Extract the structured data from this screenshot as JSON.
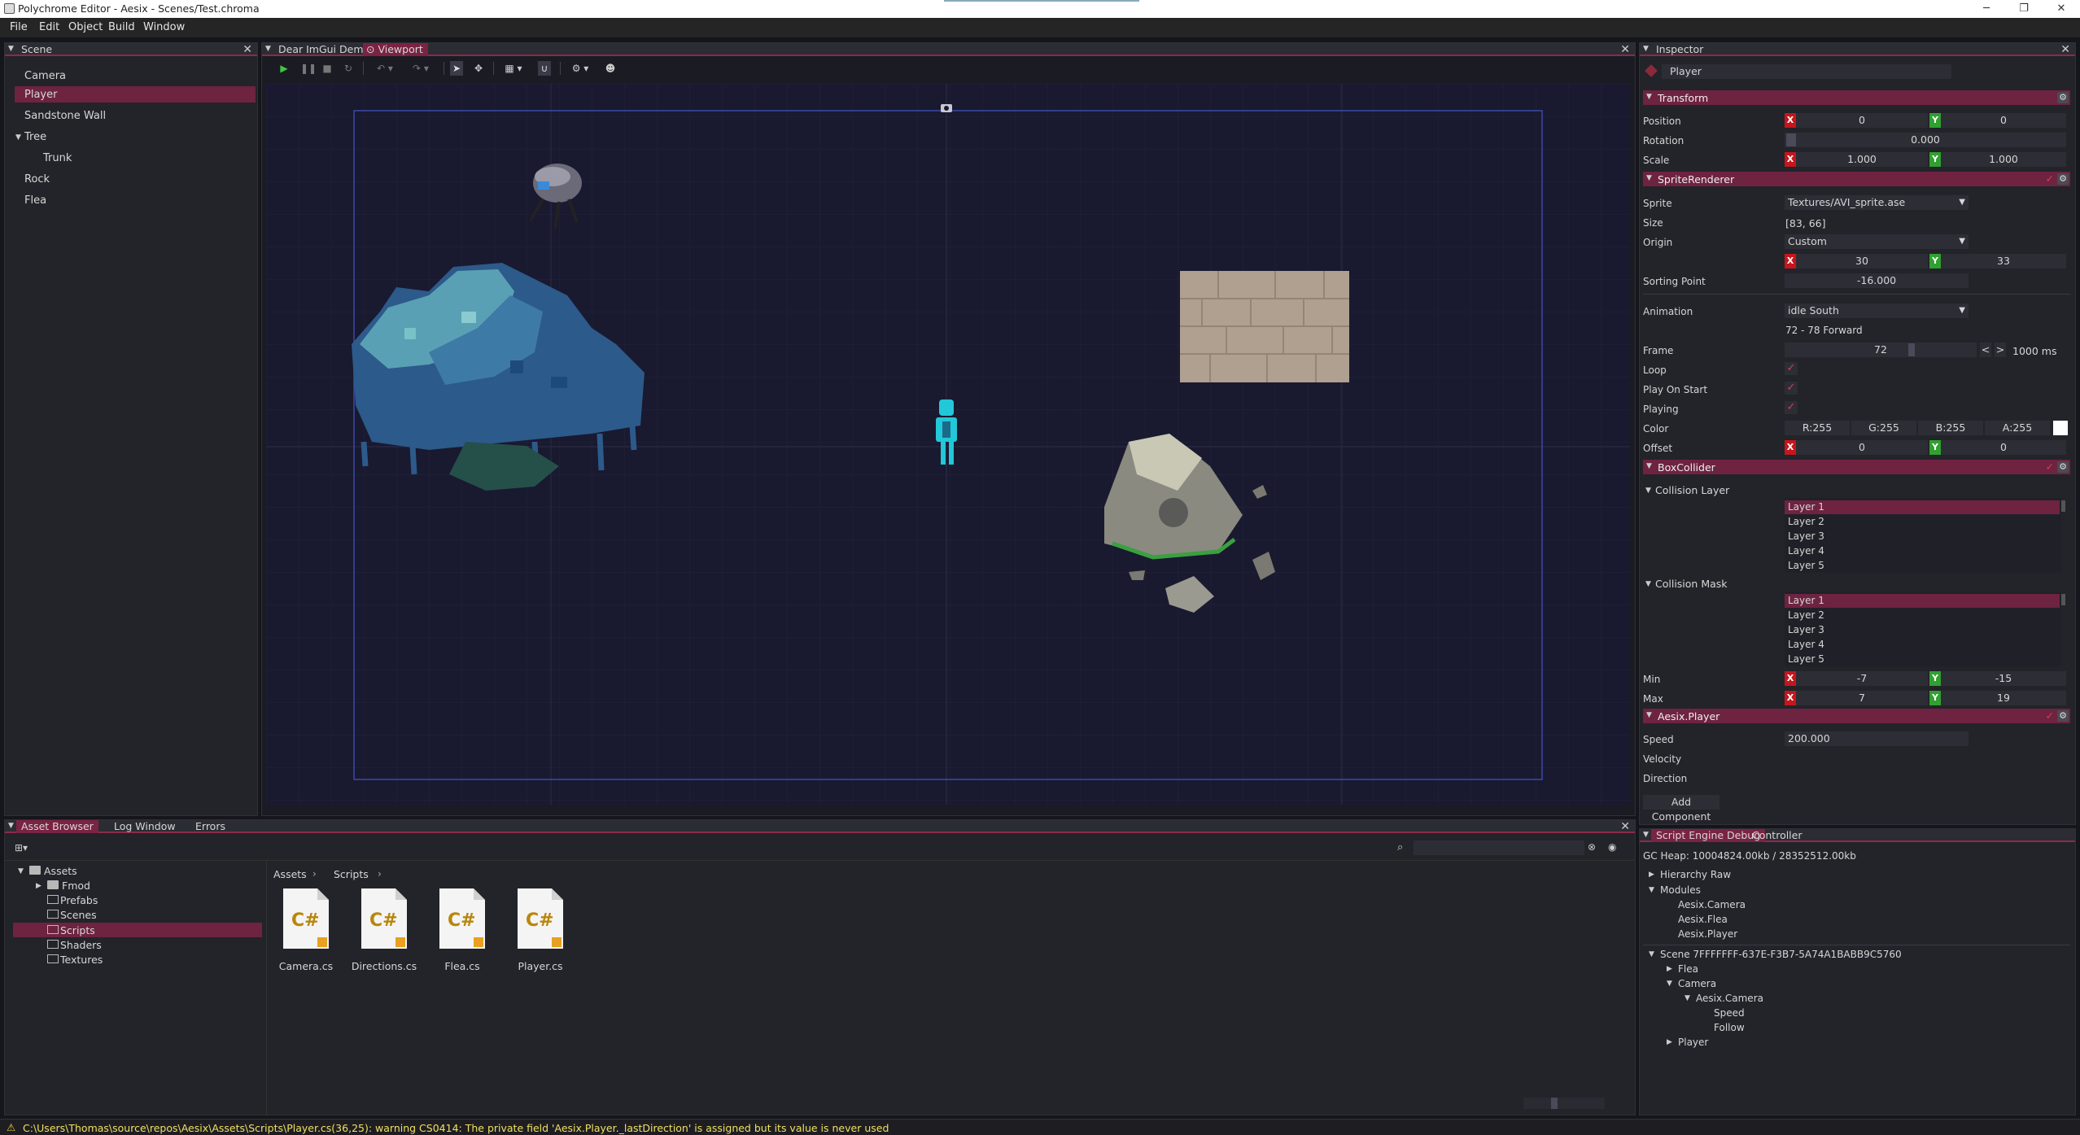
{
  "window": {
    "title": "Polychrome Editor - Aesix - Scenes/Test.chroma",
    "minimize": "─",
    "maximize": "❐",
    "close": "✕"
  },
  "menu": [
    "File",
    "Edit",
    "Object",
    "Build",
    "Window"
  ],
  "scene": {
    "tab": "Scene",
    "items": [
      "Camera",
      "Player",
      "Sandstone Wall",
      "Tree",
      "Trunk",
      "Rock",
      "Flea"
    ]
  },
  "viewport": {
    "tabs": [
      "Dear ImGui Demo",
      "Viewport"
    ]
  },
  "inspector": {
    "tab": "Inspector",
    "object_name": "Player",
    "transform": {
      "header": "Transform",
      "position_label": "Position",
      "position_x": "0",
      "position_y": "0",
      "rotation_label": "Rotation",
      "rotation": "0.000",
      "scale_label": "Scale",
      "scale_x": "1.000",
      "scale_y": "1.000"
    },
    "sprite_renderer": {
      "header": "SpriteRenderer",
      "sprite_label": "Sprite",
      "sprite": "Textures/AVI_sprite.ase",
      "size_label": "Size",
      "size": "[83, 66]",
      "origin_label": "Origin",
      "origin": "Custom",
      "origin_x": "30",
      "origin_y": "33",
      "sorting_label": "Sorting Point",
      "sorting": "-16.000",
      "animation_label": "Animation",
      "animation": "idle South",
      "anim_range": "72 - 78 Forward",
      "frame_label": "Frame",
      "frame": "72",
      "frame_ms": "1000 ms",
      "loop_label": "Loop",
      "play_on_start_label": "Play On Start",
      "playing_label": "Playing",
      "color_label": "Color",
      "color_r": "R:255",
      "color_g": "G:255",
      "color_b": "B:255",
      "color_a": "A:255",
      "offset_label": "Offset",
      "offset_x": "0",
      "offset_y": "0"
    },
    "box_collider": {
      "header": "BoxCollider",
      "collision_layer_label": "Collision Layer",
      "collision_mask_label": "Collision Mask",
      "layers": [
        "Layer 1",
        "Layer 2",
        "Layer 3",
        "Layer 4",
        "Layer 5"
      ],
      "min_label": "Min",
      "min_x": "-7",
      "min_y": "-15",
      "max_label": "Max",
      "max_x": "7",
      "max_y": "19"
    },
    "player": {
      "header": "Aesix.Player",
      "speed_label": "Speed",
      "speed": "200.000",
      "velocity_label": "Velocity",
      "direction_label": "Direction"
    },
    "add_component": "Add Component"
  },
  "assets": {
    "tabs": [
      "Asset Browser",
      "Log Window",
      "Errors"
    ],
    "tree": [
      "Assets",
      "Fmod",
      "Prefabs",
      "Scenes",
      "Scripts",
      "Shaders",
      "Textures"
    ],
    "breadcrumb": [
      "Assets",
      "Scripts"
    ],
    "files": [
      "Camera.cs",
      "Directions.cs",
      "Flea.cs",
      "Player.cs"
    ],
    "file_icon_text": "C#"
  },
  "debug": {
    "tabs": [
      "Script Engine Debug",
      "Controller"
    ],
    "gc": "GC Heap: 10004824.00kb / 28352512.00kb",
    "lines": [
      "Hierarchy Raw",
      "Modules",
      "Aesix.Camera",
      "Aesix.Flea",
      "Aesix.Player",
      "Scene 7FFFFFFF-637E-F3B7-5A74A1BABB9C5760",
      "Flea",
      "Camera",
      "Aesix.Camera",
      "Speed",
      "Follow",
      "Player"
    ]
  },
  "status": {
    "message": "C:\\Users\\Thomas\\source\\repos\\Aesix\\Assets\\Scripts\\Player.cs(36,25): warning CS0414: The private field 'Aesix.Player._lastDirection' is assigned but its value is never used"
  },
  "colors": {
    "accent": "#7a2342",
    "panel": "#23232a",
    "viewport": "#191930",
    "x": "#c4161c",
    "y": "#30a030"
  }
}
